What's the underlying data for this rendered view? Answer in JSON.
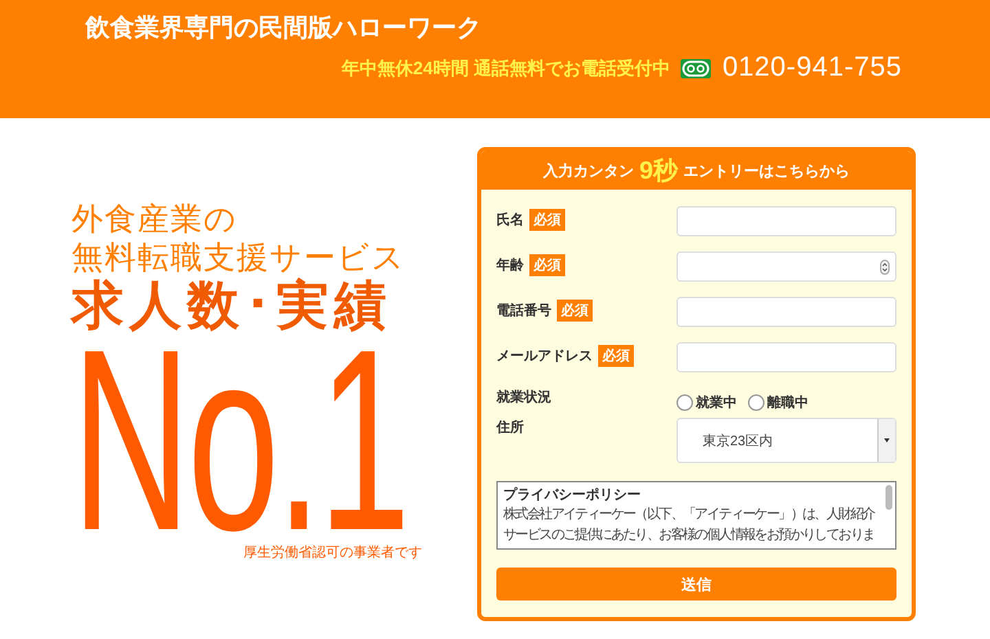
{
  "header": {
    "title": "飲食業界専門の民間版ハローワーク",
    "hours": "年中無休24時間 通話無料でお電話受付中",
    "phone": "0120-941-755"
  },
  "hero": {
    "lines": [
      "外食産業の",
      "無料転職支援サービス"
    ],
    "headline": "求人数･実績",
    "number": "No.1",
    "note": "厚生労働省認可の事業者です"
  },
  "form": {
    "heading_pre": "入力カンタン",
    "heading_highlight": "9秒",
    "heading_post": "エントリーはこちらから",
    "fields": [
      {
        "label": "氏名",
        "badge": "必須",
        "kind": "text"
      },
      {
        "label": "年齢",
        "badge": "必須",
        "kind": "number"
      },
      {
        "label": "電話番号",
        "badge": "必須",
        "kind": "text"
      },
      {
        "label": "メールアドレス",
        "badge": "必須",
        "kind": "text"
      }
    ],
    "employment": {
      "label": "就業状況",
      "options": [
        {
          "label": "就業中",
          "selected": false
        },
        {
          "label": "離職中",
          "selected": false
        }
      ]
    },
    "address": {
      "label": "住所",
      "value": "東京23区内"
    },
    "privacy": {
      "title": "プライバシーポリシー",
      "lines": [
        "株式会社アイティーケー（以下、「アイティーケー」）は、人財紹介",
        "サービスのご提供にあたり、お客様の個人情報をお預かりしておりま"
      ]
    },
    "submit": "送信"
  }
}
